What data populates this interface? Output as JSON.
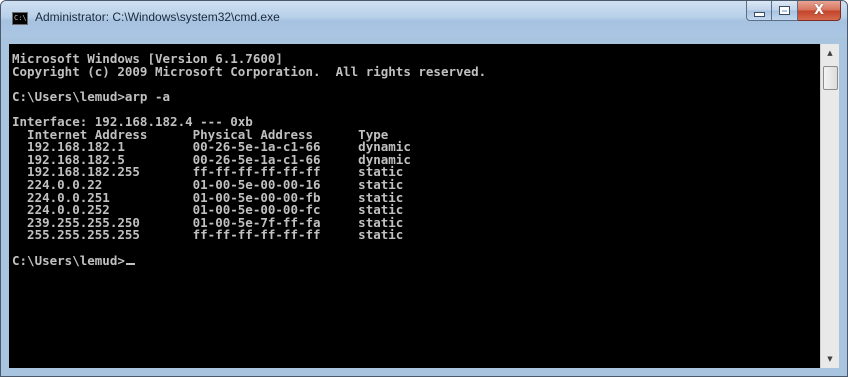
{
  "window": {
    "title": "Administrator: C:\\Windows\\system32\\cmd.exe",
    "icon": "cmd-icon",
    "icon_label": "C:\\",
    "buttons": {
      "minimize_icon": "minimize-icon",
      "maximize_icon": "maximize-icon",
      "close_icon": "close-icon",
      "close_glyph": "X"
    }
  },
  "console": {
    "foreground": "#c0c0c0",
    "background": "#000000",
    "lines": [
      "Microsoft Windows [Version 6.1.7600]",
      "Copyright (c) 2009 Microsoft Corporation.  All rights reserved.",
      "",
      "C:\\Users\\lemud>arp -a",
      "",
      "Interface: 192.168.182.4 --- 0xb",
      "  Internet Address      Physical Address      Type",
      "  192.168.182.1         00-26-5e-1a-c1-66     dynamic",
      "  192.168.182.5         00-26-5e-1a-c1-66     dynamic",
      "  192.168.182.255       ff-ff-ff-ff-ff-ff     static",
      "  224.0.0.22            01-00-5e-00-00-16     static",
      "  224.0.0.251           01-00-5e-00-00-fb     static",
      "  224.0.0.252           01-00-5e-00-00-fc     static",
      "  239.255.255.250       01-00-5e-7f-ff-fa     static",
      "  255.255.255.255       ff-ff-ff-ff-ff-ff     static",
      "",
      "C:\\Users\\lemud>"
    ]
  },
  "scrollbar": {
    "up_icon": "scroll-up-arrow-icon",
    "down_icon": "scroll-down-arrow-icon"
  }
}
